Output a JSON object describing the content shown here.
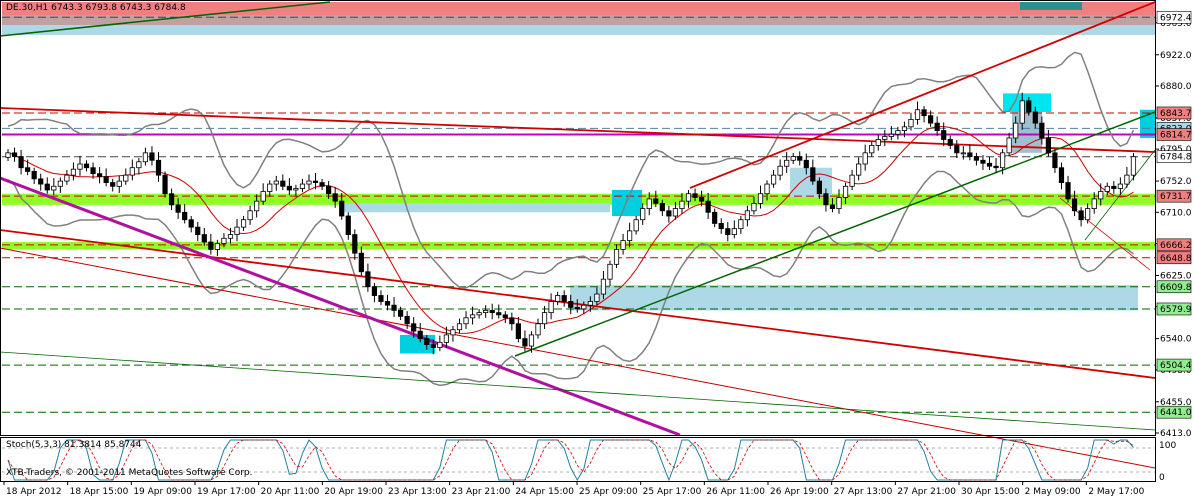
{
  "header": {
    "symbol_line": "DE.30,H1  6743.3 6793.8 6743.3 6784.8",
    "indicator_line": "Stoch(5,3,3) 81.3814 85.8744",
    "copyright": "XTB-Traders, © 2001-2011 MetaQuotes Software Corp."
  },
  "chart_data": {
    "type": "candlestick",
    "symbol": "DE.30",
    "timeframe": "H1",
    "ohlc": {
      "open": 6743.3,
      "high": 6793.8,
      "low": 6743.3,
      "close": 6784.8
    },
    "ylim": [
      6413,
      6993
    ],
    "x_ticks": [
      "18 Apr 2012",
      "18 Apr 15:00",
      "19 Apr 09:00",
      "19 Apr 17:00",
      "20 Apr 11:00",
      "20 Apr 19:00",
      "23 Apr 13:00",
      "23 Apr 21:00",
      "24 Apr 15:00",
      "25 Apr 09:00",
      "25 Apr 17:00",
      "26 Apr 11:00",
      "26 Apr 19:00",
      "27 Apr 13:00",
      "27 Apr 21:00",
      "30 Apr 15:00",
      "2 May 09:00",
      "2 May 17:00"
    ],
    "y_ticks": [
      6413.0,
      6455.0,
      6498.0,
      6540.0,
      6583.0,
      6625.0,
      6668.0,
      6710.0,
      6752.0,
      6795.0,
      6837.0,
      6880.0,
      6922.0,
      6965.0
    ],
    "price_tags": [
      {
        "value": 6972.4,
        "text": "6972.4",
        "color": "#ffffff"
      },
      {
        "value": 6843.7,
        "text": "6843.7",
        "color": "#f08080"
      },
      {
        "value": 6823.0,
        "text": "6823.0",
        "color": "#add8e6"
      },
      {
        "value": 6814.7,
        "text": "6814.7",
        "color": "#f08080"
      },
      {
        "value": 6784.8,
        "text": "6784.8",
        "color": "#ffffff"
      },
      {
        "value": 6731.7,
        "text": "6731.7",
        "color": "#f08080"
      },
      {
        "value": 6666.2,
        "text": "6666.2",
        "color": "#f08080"
      },
      {
        "value": 6648.8,
        "text": "6648.8",
        "color": "#f08080"
      },
      {
        "value": 6609.8,
        "text": "6609.8",
        "color": "#90ee90"
      },
      {
        "value": 6579.9,
        "text": "6579.9",
        "color": "#90ee90"
      },
      {
        "value": 6504.4,
        "text": "6504.4",
        "color": "#90ee90"
      },
      {
        "value": 6441.0,
        "text": "6441.0",
        "color": "#90ee90"
      }
    ],
    "closes": [
      6790,
      6785,
      6770,
      6765,
      6755,
      6748,
      6740,
      6745,
      6752,
      6760,
      6768,
      6775,
      6770,
      6762,
      6758,
      6750,
      6745,
      6752,
      6760,
      6770,
      6778,
      6790,
      6780,
      6760,
      6735,
      6720,
      6710,
      6700,
      6690,
      6680,
      6670,
      6660,
      6668,
      6675,
      6680,
      6690,
      6700,
      6712,
      6725,
      6738,
      6748,
      6752,
      6745,
      6740,
      6742,
      6748,
      6752,
      6750,
      6745,
      6735,
      6725,
      6705,
      6680,
      6655,
      6630,
      6610,
      6598,
      6590,
      6585,
      6578,
      6570,
      6560,
      6550,
      6540,
      6532,
      6528,
      6535,
      6545,
      6552,
      6560,
      6568,
      6572,
      6575,
      6578,
      6575,
      6572,
      6568,
      6560,
      6540,
      6530,
      6545,
      6560,
      6575,
      6590,
      6598,
      6590,
      6582,
      6580,
      6585,
      6590,
      6600,
      6620,
      6640,
      6660,
      6672,
      6685,
      6700,
      6715,
      6728,
      6722,
      6712,
      6705,
      6715,
      6725,
      6735,
      6730,
      6725,
      6710,
      6695,
      6688,
      6680,
      6688,
      6700,
      6712,
      6722,
      6735,
      6748,
      6760,
      6772,
      6780,
      6785,
      6780,
      6770,
      6752,
      6735,
      6720,
      6715,
      6730,
      6745,
      6760,
      6775,
      6790,
      6800,
      6808,
      6812,
      6815,
      6820,
      6825,
      6835,
      6848,
      6840,
      6830,
      6820,
      6808,
      6800,
      6790,
      6790,
      6785,
      6780,
      6776,
      6772,
      6770,
      6790,
      6810,
      6830,
      6860,
      6845,
      6830,
      6810,
      6790,
      6770,
      6750,
      6728,
      6712,
      6700,
      6715,
      6728,
      6738,
      6745,
      6742,
      6748,
      6760,
      6784.8
    ],
    "stochastic": {
      "name": "Stoch(5,3,3)",
      "main": 81.3814,
      "signal": 85.8744,
      "levels": [
        20,
        80
      ],
      "ylim": [
        0,
        100
      ]
    }
  }
}
